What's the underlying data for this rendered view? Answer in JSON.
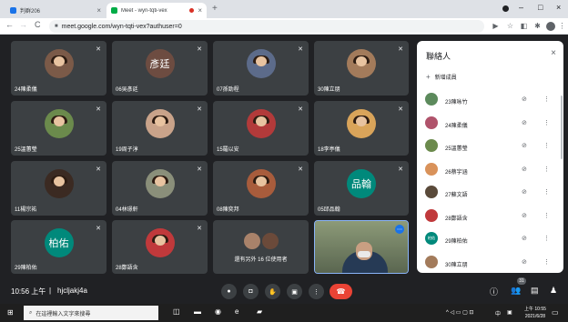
{
  "browser": {
    "tabs": [
      {
        "label": "判群206",
        "favicon_color": "#1a73e8",
        "close": "×"
      },
      {
        "label": "Meet - wyn-tqti-vex",
        "favicon_color": "#00ac47",
        "close": "×"
      }
    ],
    "new_tab": "+",
    "window_controls": [
      "–",
      "□",
      "×"
    ],
    "url": "meet.google.com/wyn-tqti-vex?authuser=0"
  },
  "tiles": [
    {
      "name": "24陳柔儀",
      "avatar": "photo",
      "color": "#7b5a48"
    },
    {
      "name": "06吳彥廷",
      "avatar": "initials",
      "initials": "彥廷",
      "color": "#6d4c41"
    },
    {
      "name": "07孫勁程",
      "avatar": "photo",
      "color": "#5c6b8a"
    },
    {
      "name": "30陳立朋",
      "avatar": "photo",
      "color": "#a37b5b"
    },
    {
      "name": "25溫蕙瑩",
      "avatar": "photo",
      "color": "#6b8a4c"
    },
    {
      "name": "19周子淳",
      "avatar": "photo",
      "color": "#c9a38a"
    },
    {
      "name": "15羅以安",
      "avatar": "photo",
      "color": "#b23a3a"
    },
    {
      "name": "18李亭儀",
      "avatar": "photo",
      "color": "#d9a45a"
    },
    {
      "name": "11楊宗祐",
      "avatar": "photo",
      "color": "#3b2a22"
    },
    {
      "name": "04林璟軒",
      "avatar": "photo",
      "color": "#8a8f7a"
    },
    {
      "name": "08陳奕邦",
      "avatar": "photo",
      "color": "#a85c3c"
    },
    {
      "name": "05邱品翰",
      "avatar": "initials",
      "initials": "品翰",
      "color": "#00897b"
    },
    {
      "name": "29陳柏佑",
      "avatar": "initials",
      "initials": "柏佑",
      "color": "#00897b"
    },
    {
      "name": "28鄭語含",
      "avatar": "photo",
      "color": "#c0393b"
    }
  ],
  "more_tile": {
    "text": "還有另外 16 位使用者"
  },
  "self_tile": {
    "more": "⋯"
  },
  "bottom_bar": {
    "time": "10:56 上午",
    "separator": "|",
    "meeting_code": "hjcljakj4a",
    "end_call": "☎"
  },
  "participant_count": "31",
  "people_panel": {
    "title": "聯絡人",
    "close": "×",
    "add_label": "新增成員",
    "people": [
      {
        "name": "23陳咏竹",
        "color": "#5c8a5c"
      },
      {
        "name": "24陳柔儀",
        "color": "#b0536b"
      },
      {
        "name": "25溫蕙瑩",
        "color": "#6b8a4c"
      },
      {
        "name": "26蔡宇涵",
        "color": "#d9925a"
      },
      {
        "name": "27蘇文語",
        "color": "#5a4a3a"
      },
      {
        "name": "28鄭語含",
        "color": "#c0393b"
      },
      {
        "name": "29陳柏佑",
        "color": "#00897b",
        "initials": "柏佑"
      },
      {
        "name": "30陳立朋",
        "color": "#a37b5b"
      }
    ]
  },
  "taskbar": {
    "search_placeholder": "在這裡輸入文字來搜尋",
    "ime": "中",
    "clock_time": "上午 10:55",
    "clock_date": "2021/6/28"
  }
}
